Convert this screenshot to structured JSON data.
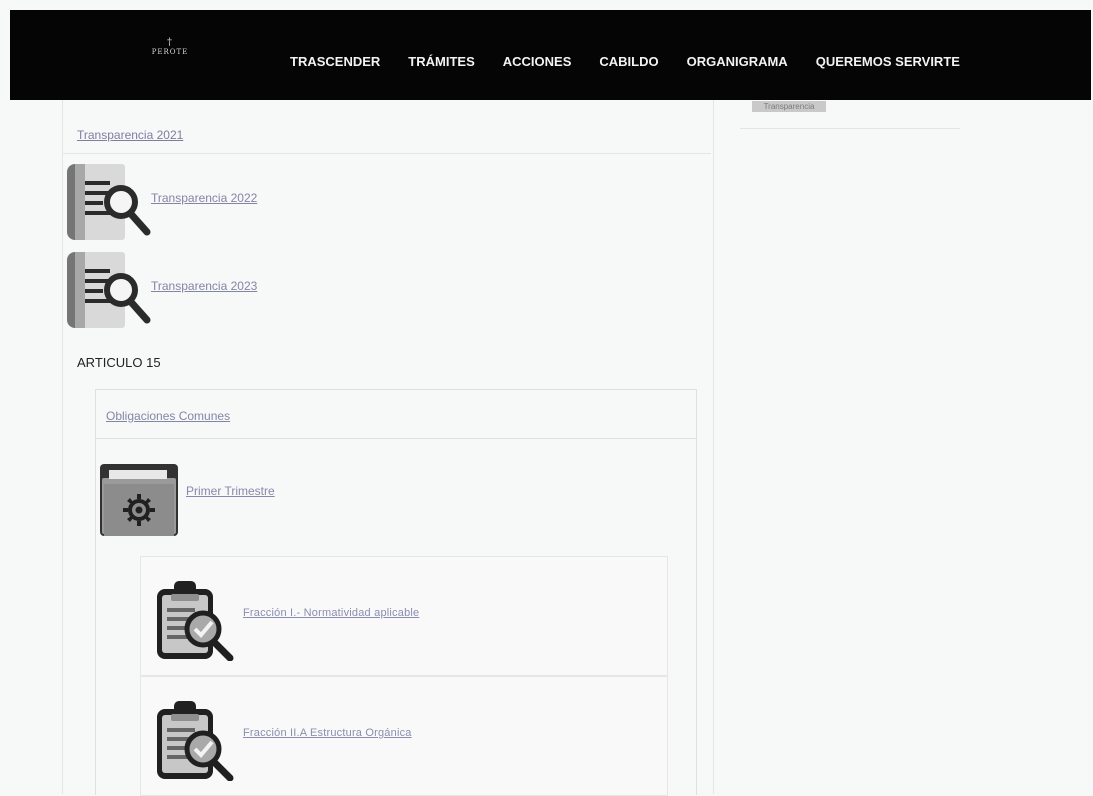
{
  "header": {
    "logo_text": "PEROTE",
    "logo_mark": "†",
    "nav": [
      "TRASCENDER",
      "TRÁMITES",
      "ACCIONES",
      "CABILDO",
      "ORGANIGRAMA",
      "QUEREMOS SERVIRTE"
    ]
  },
  "sidebar": {
    "label": "Transparencia"
  },
  "content": {
    "top_link": "Transparencia 2021",
    "documents": [
      {
        "label": "Transparencia 2022"
      },
      {
        "label": "Transparencia 2023"
      }
    ],
    "article_heading": "ARTICULO 15",
    "obligaciones_link": "Obligaciones Comunes",
    "primer_trimestre": "Primer Trimestre",
    "fractions": [
      {
        "label": "Fracción I.- Normatividad aplicable"
      },
      {
        "label": "Fracción II.A Estructura Orgánica"
      }
    ]
  },
  "icons": {
    "document": "document-search-icon",
    "folder": "folder-gear-icon",
    "clipboard": "clipboard-check-icon"
  },
  "colors": {
    "header": "#050505",
    "link": "#7d7fa0",
    "icon_gray": "#8d8d8d"
  }
}
